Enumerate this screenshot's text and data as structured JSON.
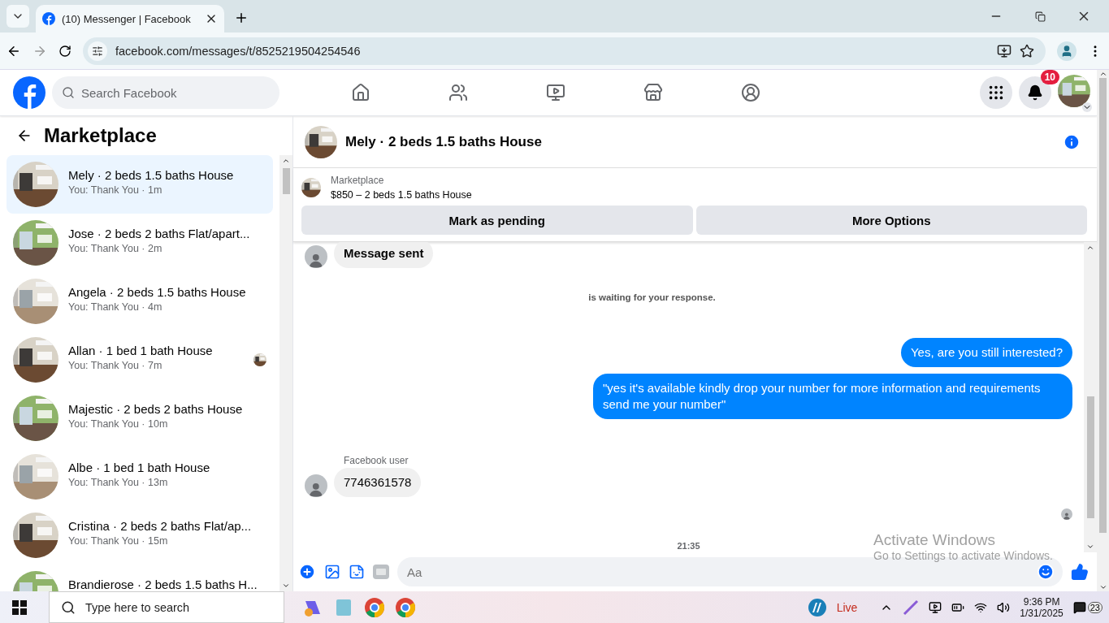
{
  "browser": {
    "tab_title": "(10) Messenger | Facebook",
    "url": "facebook.com/messages/t/8525219504254546"
  },
  "header": {
    "search_placeholder": "Search Facebook",
    "notification_count": "10",
    "nav": [
      {
        "kind": "home",
        "selected": false
      },
      {
        "kind": "friends",
        "selected": false
      },
      {
        "kind": "video",
        "selected": false
      },
      {
        "kind": "marketplace",
        "selected": false
      },
      {
        "kind": "groups",
        "selected": false
      }
    ]
  },
  "sidebar": {
    "title": "Marketplace",
    "conversations": [
      {
        "title": "Mely · 2 beds 1.5 baths House",
        "preview": "You: Thank You · 1m",
        "selected": true,
        "seen": false
      },
      {
        "title": "Jose · 2 beds 2 baths Flat/apart...",
        "preview": "You: Thank You · 2m",
        "selected": false,
        "seen": false
      },
      {
        "title": "Angela · 2 beds 1.5 baths House",
        "preview": "You: Thank You · 4m",
        "selected": false,
        "seen": false
      },
      {
        "title": "Allan · 1 bed 1 bath House",
        "preview": "You: Thank You · 7m",
        "selected": false,
        "seen": true
      },
      {
        "title": "Majestic · 2 beds 2 baths House",
        "preview": "You: Thank You · 10m",
        "selected": false,
        "seen": false
      },
      {
        "title": "Albe · 1 bed 1 bath House",
        "preview": "You: Thank You · 13m",
        "selected": false,
        "seen": false
      },
      {
        "title": "Cristina · 2 beds 2 baths Flat/ap...",
        "preview": "You: Thank You · 15m",
        "selected": false,
        "seen": false
      },
      {
        "title": "Brandierose · 2 beds 1.5 baths H...",
        "selected": false,
        "seen": false
      }
    ]
  },
  "chat": {
    "title": "Mely · 2 beds 1.5 baths House",
    "listing": {
      "label": "Marketplace",
      "summary": "$850 – 2 beds 1.5 baths House"
    },
    "actions": [
      "Mark as pending",
      "More Options"
    ],
    "messages": [
      {
        "kind": "incoming",
        "text": "Message sent",
        "bold": true
      },
      {
        "kind": "notice",
        "text": "is waiting for your response."
      },
      {
        "kind": "outgoing",
        "text": "Yes, are you still interested?"
      },
      {
        "kind": "outgoing",
        "text": "\"yes it's available kindly drop your number for more information and requirements send me your number\""
      },
      {
        "kind": "incoming",
        "sender": "Facebook user",
        "text": "7746361578",
        "bold": false
      },
      {
        "kind": "seen"
      },
      {
        "kind": "time",
        "text": "21:35"
      }
    ],
    "composer": {
      "placeholder": "Aa"
    }
  },
  "os_notice": {
    "title": "Activate Windows",
    "text": "Go to Settings to activate Windows."
  },
  "taskbar": {
    "search_placeholder": "Type here to search",
    "weather": "Live",
    "time": "9:36 PM",
    "date": "1/31/2025",
    "notifications": "23"
  }
}
